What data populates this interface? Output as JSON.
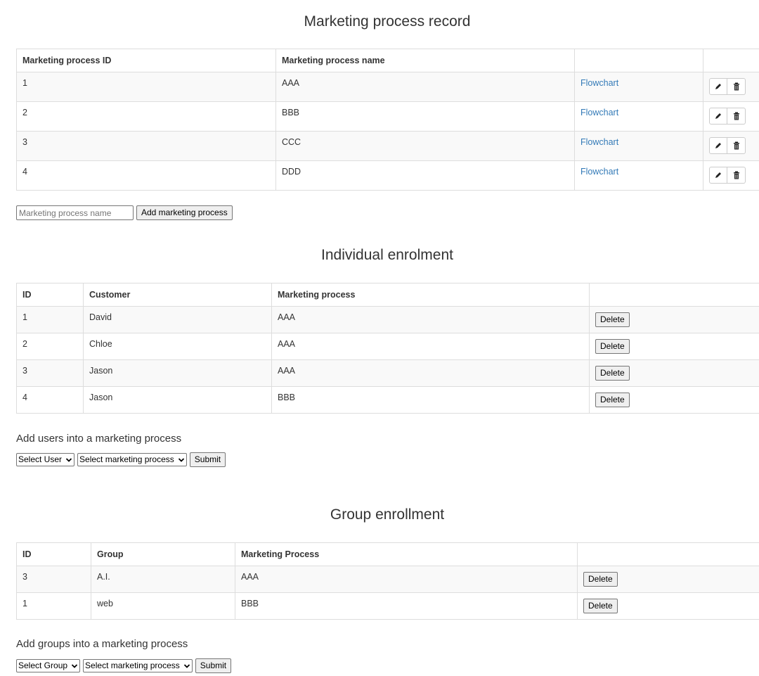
{
  "marketing_record": {
    "title": "Marketing process record",
    "headers": [
      "Marketing process ID",
      "Marketing process name",
      "",
      ""
    ],
    "rows": [
      {
        "id": "1",
        "name": "AAA",
        "link": "Flowchart"
      },
      {
        "id": "2",
        "name": "BBB",
        "link": "Flowchart"
      },
      {
        "id": "3",
        "name": "CCC",
        "link": "Flowchart"
      },
      {
        "id": "4",
        "name": "DDD",
        "link": "Flowchart"
      }
    ],
    "row_icons": {
      "edit": "pencil-icon",
      "delete": "trash-icon"
    },
    "input_placeholder": "Marketing process name",
    "input_value": "",
    "add_button": "Add marketing process"
  },
  "individual": {
    "title": "Individual enrolment",
    "headers": [
      "ID",
      "Customer",
      "Marketing process",
      ""
    ],
    "rows": [
      {
        "id": "1",
        "customer": "David",
        "process": "AAA",
        "action": "Delete"
      },
      {
        "id": "2",
        "customer": "Chloe",
        "process": "AAA",
        "action": "Delete"
      },
      {
        "id": "3",
        "customer": "Jason",
        "process": "AAA",
        "action": "Delete"
      },
      {
        "id": "4",
        "customer": "Jason",
        "process": "BBB",
        "action": "Delete"
      }
    ],
    "add_label": "Add users into a marketing process",
    "select_user": "Select User",
    "select_process": "Select marketing process",
    "submit": "Submit"
  },
  "group": {
    "title": "Group enrollment",
    "headers": [
      "ID",
      "Group",
      "Marketing Process",
      ""
    ],
    "rows": [
      {
        "id": "3",
        "group": "A.I.",
        "process": "AAA",
        "action": "Delete"
      },
      {
        "id": "1",
        "group": "web",
        "process": "BBB",
        "action": "Delete"
      }
    ],
    "add_label": "Add groups into a marketing process",
    "select_group": "Select Group",
    "select_process": "Select marketing process",
    "submit": "Submit"
  },
  "colors": {
    "link": "#337ab7",
    "border": "#dddddd",
    "stripe": "#f9f9f9",
    "text": "#333333"
  }
}
